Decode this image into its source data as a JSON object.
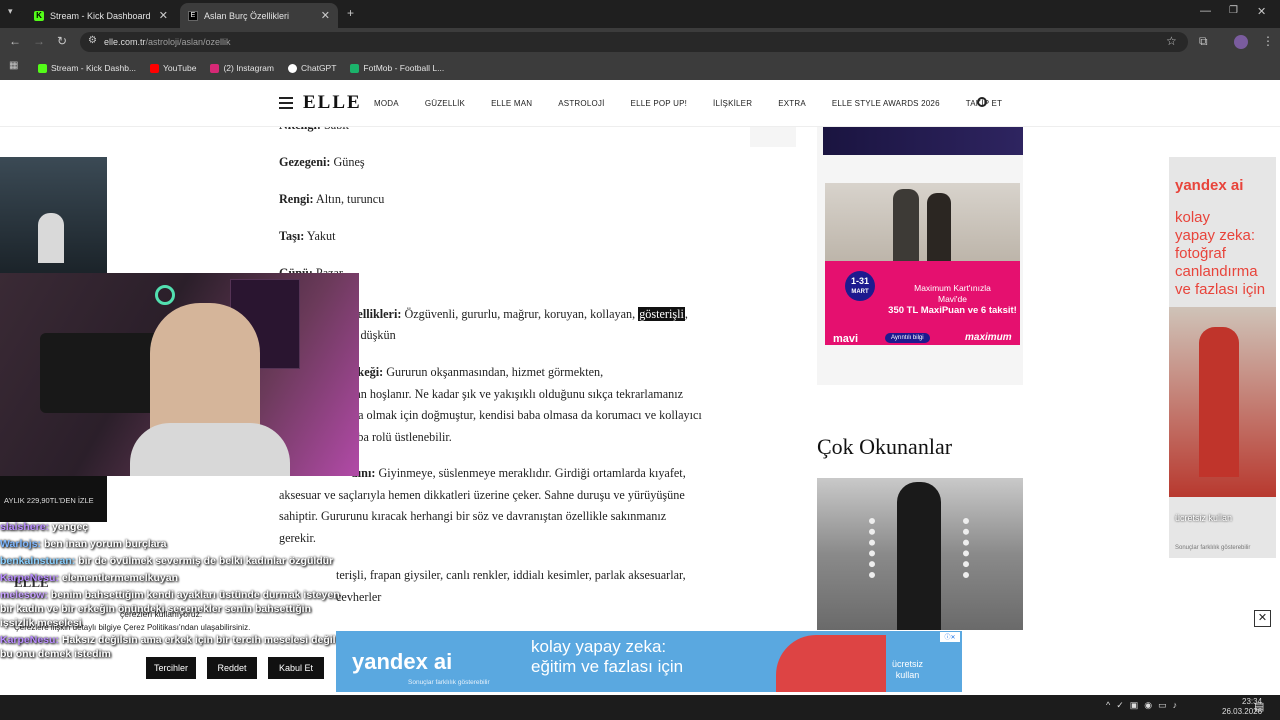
{
  "browser": {
    "tabs": [
      {
        "title": "Stream - Kick Dashboard"
      },
      {
        "title": "Aslan Burç Özellikleri"
      }
    ],
    "url_host": "elle.com.tr",
    "url_path": "/astroloji/aslan/ozellik",
    "bookmarks": [
      {
        "label": "Stream - Kick Dashb...",
        "color": "#53fc18"
      },
      {
        "label": "YouTube",
        "color": "#ff0000"
      },
      {
        "label": "(2) Instagram",
        "color": "#d62976"
      },
      {
        "label": "ChatGPT",
        "color": "#ffffff"
      },
      {
        "label": "FotMob - Football L...",
        "color": "#1bb36b"
      }
    ]
  },
  "site": {
    "logo": "ELLE",
    "nav": [
      "MODA",
      "GÜZELLİK",
      "ELLE MAN",
      "ASTROLOJİ",
      "ELLE POP UP!",
      "İLİŞKİLER",
      "EXTRA",
      "ELLE STYLE AWARDS 2026",
      "TAKİP ET"
    ]
  },
  "article": {
    "nitelik_label": "Niteliği:",
    "nitelik_value": "Sabit",
    "gezegen_label": "Gezegeni:",
    "gezegen_value": "Güneş",
    "renk_label": "Rengi:",
    "renk_value": "Altın, turuncu",
    "tas_label": "Taşı:",
    "tas_value": "Yakut",
    "gun_label": "Günü:",
    "gun_value": "Pazar",
    "ozellik_label": "zellikleri:",
    "ozellik_value": "Özgüvenli, gururlu, mağrur, koruyan, kollayan,",
    "ozellik_hl": "gösterişli",
    "ozellik_line2": "e düşkün",
    "erkek_label": "rkeği:",
    "erkek_line1": "Gururun okşanmasından, hizmet görmekten,",
    "erkek_line2": "tan hoşlanır. Ne kadar şık ve yakışıklı olduğunu sıkça tekrarlamanız",
    "erkek_line3": "ba olmak için doğmuştur, kendisi baba olmasa da korumacı ve kollayıcı",
    "erkek_line4": "aba rolü üstlenebilir.",
    "kadin_label": "dını:",
    "kadin_line1": "Giyinmeye, süslenmeye meraklıdır. Girdiği ortamlarda kıyafet,",
    "kadin_line2": "aksesuar ve saçlarıyla hemen dikkatleri üzerine çeker. Sahne duruşu ve yürüyüşüne",
    "kadin_line3": "sahiptir. Gururunu kıracak herhangi bir söz ve davranıştan özellikle sakınmanız",
    "kadin_line4": "gerekir.",
    "stil_line1": "terişli, frapan giysiler, canlı renkler, iddialı kesimler, parlak aksesuarlar,",
    "stil_line2": "cevherler"
  },
  "sidebar": {
    "ad_promo_date": "1-31",
    "ad_promo_month": "MART",
    "ad_promo_line1": "Maximum Kart'ınızla",
    "ad_promo_line2": "Mavi'de",
    "ad_promo_line3": "350 TL MaxiPuan ve 6 taksit!",
    "ad_brand1": "mavi",
    "ad_button": "Ayrıntılı bilgi",
    "ad_brand2": "maximum",
    "cok_okunanlar": "Çok Okunanlar"
  },
  "yandex_side": {
    "brand": "yandex ai",
    "line1": "kolay",
    "line2": "yapay zeka:",
    "line3": "fotoğraf",
    "line4": "canlandırma",
    "line5": "ve fazlası için",
    "cta": "ücretsiz kullan",
    "footer": "Sonuçlar farklılık gösterebilir"
  },
  "yandex_bottom": {
    "brand": "yandex ai",
    "line1": "kolay yapay zeka:",
    "line2": "eğitim ve fazlası için",
    "cta1": "ücretsiz",
    "cta2": "kullan",
    "footer": "Sonuçlar farklılık gösterebilir"
  },
  "stream": {
    "sub_label": "AYLIK 229,90TL'DEN İZLE",
    "chat": [
      {
        "user": "slaishere:",
        "msg": "yengeç",
        "color": "#b98cff"
      },
      {
        "user": "Warlojs:",
        "msg": "ben inan yorum burçlara",
        "color": "#7fb8ff"
      },
      {
        "user": "benkalnsturan:",
        "msg": "bir de övülmek severmiş de belki kadınlar özgüldür",
        "color": "#8ad0ff"
      },
      {
        "user": "KarpeNesu:",
        "msg": "elementlermemelkuyan",
        "color": "#b98cff"
      },
      {
        "user": "melesow:",
        "msg": "benim bahsettiğim kendi ayakları üstünde durmak isteyen bir kadın ve bir erkeğin önündeki seçenekler senin bahsettiğin işsizlik meselesi",
        "color": "#c6a0ff"
      },
      {
        "user": "KarpeNesu:",
        "msg": "Haksız değilsin ama erkek için bir tercih meselesi değil bu onu demek istedim",
        "color": "#b98cff"
      }
    ]
  },
  "cookie": {
    "line1": "çerezleri kullanıyoruz.",
    "line2": "Çerezlere ilişkin detaylı bilgiye Çerez Politikası'ndan ulaşabilirsiniz.",
    "btn1": "Tercihler",
    "btn2": "Reddet",
    "btn3": "Kabul Et"
  },
  "taskbar": {
    "time": "23:34",
    "date": "26.03.2026"
  }
}
